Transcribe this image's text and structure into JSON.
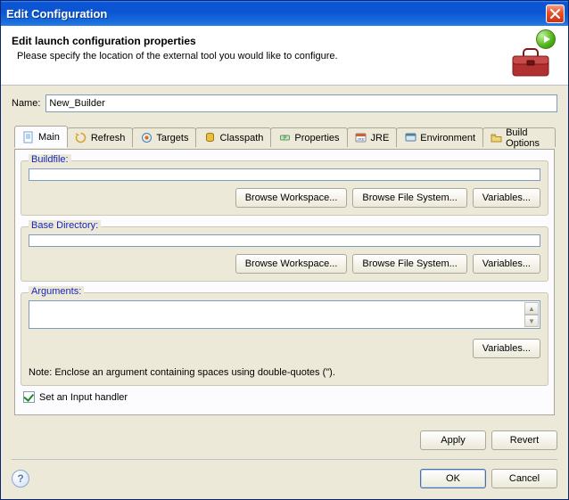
{
  "window": {
    "title": "Edit Configuration"
  },
  "banner": {
    "heading": "Edit launch configuration properties",
    "description": "Please specify the location of the external tool you would like to configure."
  },
  "name": {
    "label": "Name:",
    "value": "New_Builder"
  },
  "tabs": [
    {
      "id": "main",
      "label": "Main",
      "icon": "doc"
    },
    {
      "id": "refresh",
      "label": "Refresh",
      "icon": "refresh"
    },
    {
      "id": "targets",
      "label": "Targets",
      "icon": "target"
    },
    {
      "id": "classpath",
      "label": "Classpath",
      "icon": "jar"
    },
    {
      "id": "properties",
      "label": "Properties",
      "icon": "tag"
    },
    {
      "id": "jre",
      "label": "JRE",
      "icon": "jre"
    },
    {
      "id": "environment",
      "label": "Environment",
      "icon": "env"
    },
    {
      "id": "buildopts",
      "label": "Build Options",
      "icon": "folder"
    }
  ],
  "main": {
    "buildfile": {
      "title": "Buildfile:",
      "value": "",
      "browse_ws": "Browse Workspace...",
      "browse_fs": "Browse File System...",
      "variables": "Variables..."
    },
    "basedir": {
      "title": "Base Directory:",
      "value": "",
      "browse_ws": "Browse Workspace...",
      "browse_fs": "Browse File System...",
      "variables": "Variables..."
    },
    "arguments": {
      "title": "Arguments:",
      "value": "",
      "variables": "Variables...",
      "note": "Note: Enclose an argument containing spaces using double-quotes (\")."
    },
    "input_handler": {
      "label": "Set an Input handler",
      "checked": true
    }
  },
  "buttons": {
    "apply": "Apply",
    "revert": "Revert",
    "ok": "OK",
    "cancel": "Cancel"
  }
}
